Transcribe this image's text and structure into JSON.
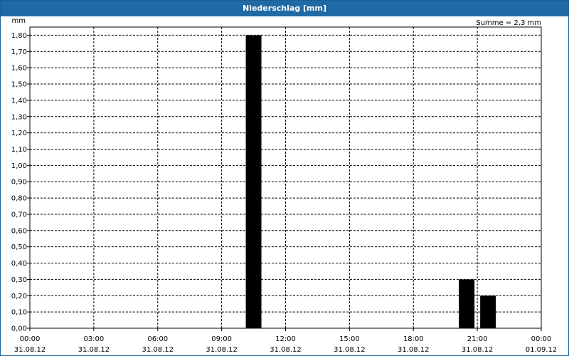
{
  "window": {
    "title": "Niederschlag [mm]"
  },
  "chart_data": {
    "type": "bar",
    "title": "Niederschlag [mm]",
    "ylabel": "mm",
    "annotation": "Summe = 2,3 mm",
    "ylim": [
      0,
      1.85
    ],
    "y_ticks": [
      "0,00",
      "0,10",
      "0,20",
      "0,30",
      "0,40",
      "0,50",
      "0,60",
      "0,70",
      "0,80",
      "0,90",
      "1,00",
      "1,10",
      "1,20",
      "1,30",
      "1,40",
      "1,50",
      "1,60",
      "1,70",
      "1,80"
    ],
    "x_ticks": [
      {
        "time": "00:00",
        "date": "31.08.12"
      },
      {
        "time": "03:00",
        "date": "31.08.12"
      },
      {
        "time": "06:00",
        "date": "31.08.12"
      },
      {
        "time": "09:00",
        "date": "31.08.12"
      },
      {
        "time": "12:00",
        "date": "31.08.12"
      },
      {
        "time": "15:00",
        "date": "31.08.12"
      },
      {
        "time": "18:00",
        "date": "31.08.12"
      },
      {
        "time": "21:00",
        "date": "31.08.12"
      },
      {
        "time": "00:00",
        "date": "01.09.12"
      }
    ],
    "grid": true,
    "bars": [
      {
        "start": "10:00",
        "end": "11:00",
        "value": 1.8
      },
      {
        "start": "20:00",
        "end": "21:00",
        "value": 0.3
      },
      {
        "start": "21:00",
        "end": "22:00",
        "value": 0.2
      }
    ]
  }
}
